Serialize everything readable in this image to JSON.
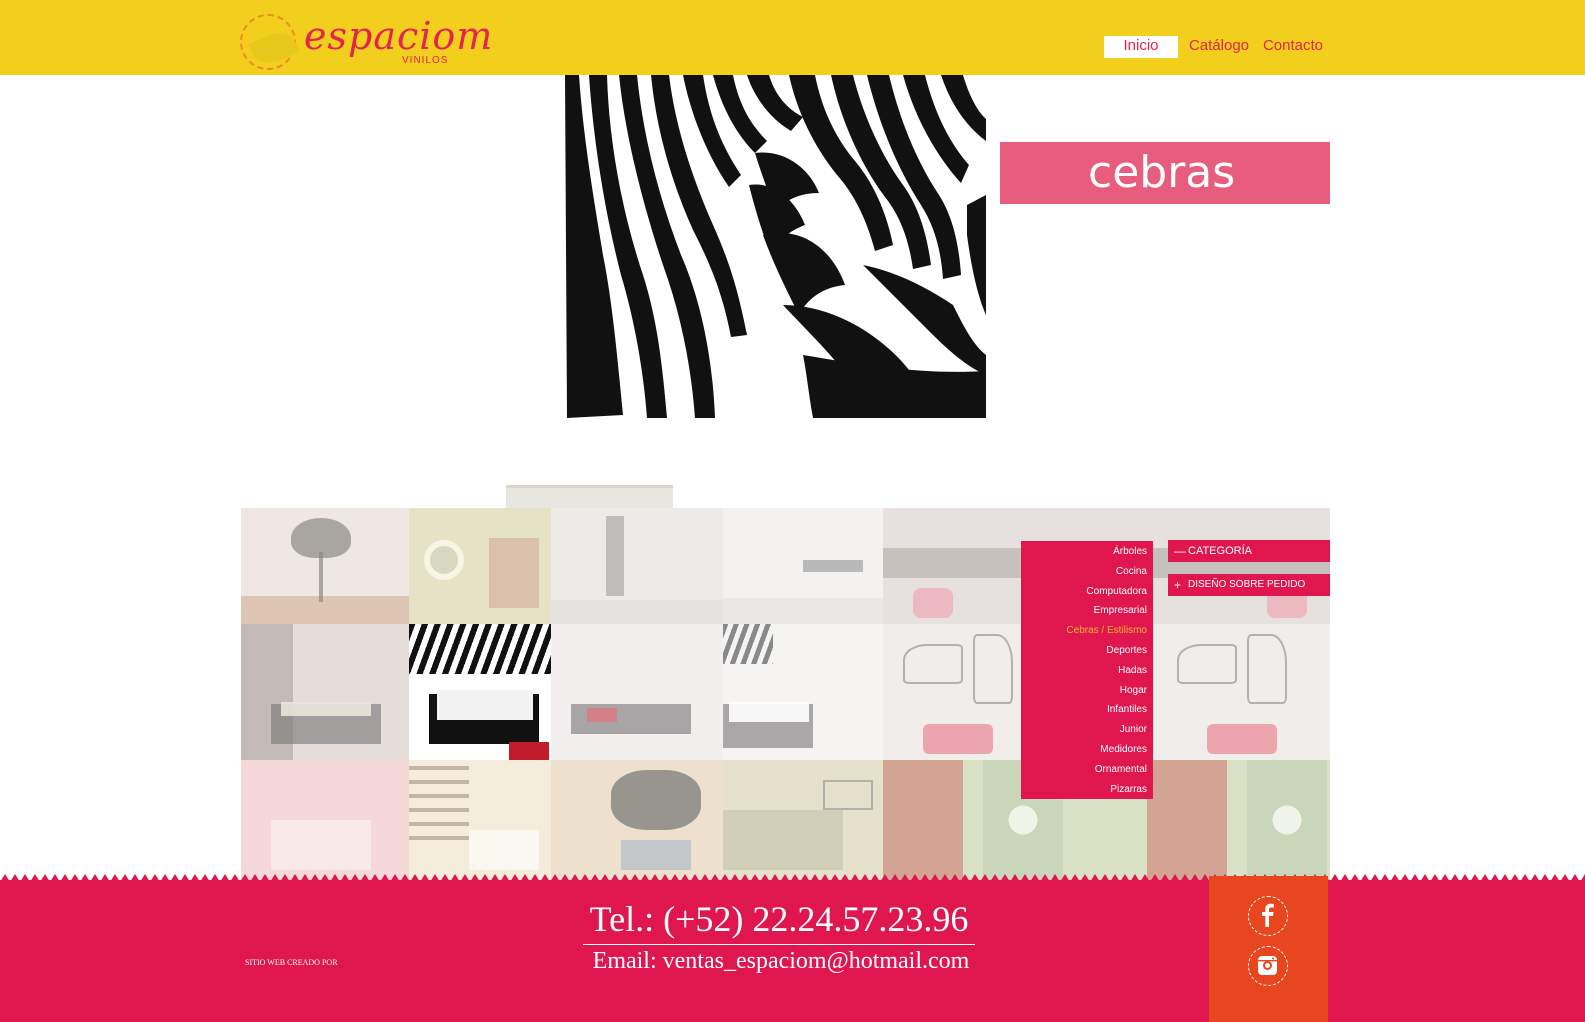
{
  "brand": {
    "name": "espaciom",
    "tagline": "VINILOS",
    "color": "#e4234e"
  },
  "nav": {
    "items": [
      "Inicio",
      "Catálogo",
      "Contacto"
    ],
    "active": "Inicio"
  },
  "hero": {
    "title": "cebras"
  },
  "menu": {
    "header": "CATEGORÍA",
    "header_symbol": "—",
    "custom_label": "DISEÑO SOBRE PEDIDO",
    "custom_symbol": "+",
    "categories": [
      "Árboles",
      "Cocina",
      "Computadora",
      "Empresarial",
      "Cebras / Estilismo",
      "Deportes",
      "Hadas",
      "Hogar",
      "Infantiles",
      "Junior",
      "Medidores",
      "Ornamental",
      "Pizarras"
    ],
    "active_category": "Cebras / Estilismo"
  },
  "footer": {
    "credit": "SITIO WEB CREADO POR",
    "phone": "Tel.: (+52) 22.24.57.23.96",
    "email": "Email: ventas_espaciom@hotmail.com",
    "social": [
      "facebook-icon",
      "instagram-icon"
    ]
  },
  "colors": {
    "header_bg": "#f2cf1c",
    "accent": "#e0174f",
    "title_box": "#e85c7d",
    "social_bg": "#e8461f",
    "active_category": "#f7b52a"
  }
}
